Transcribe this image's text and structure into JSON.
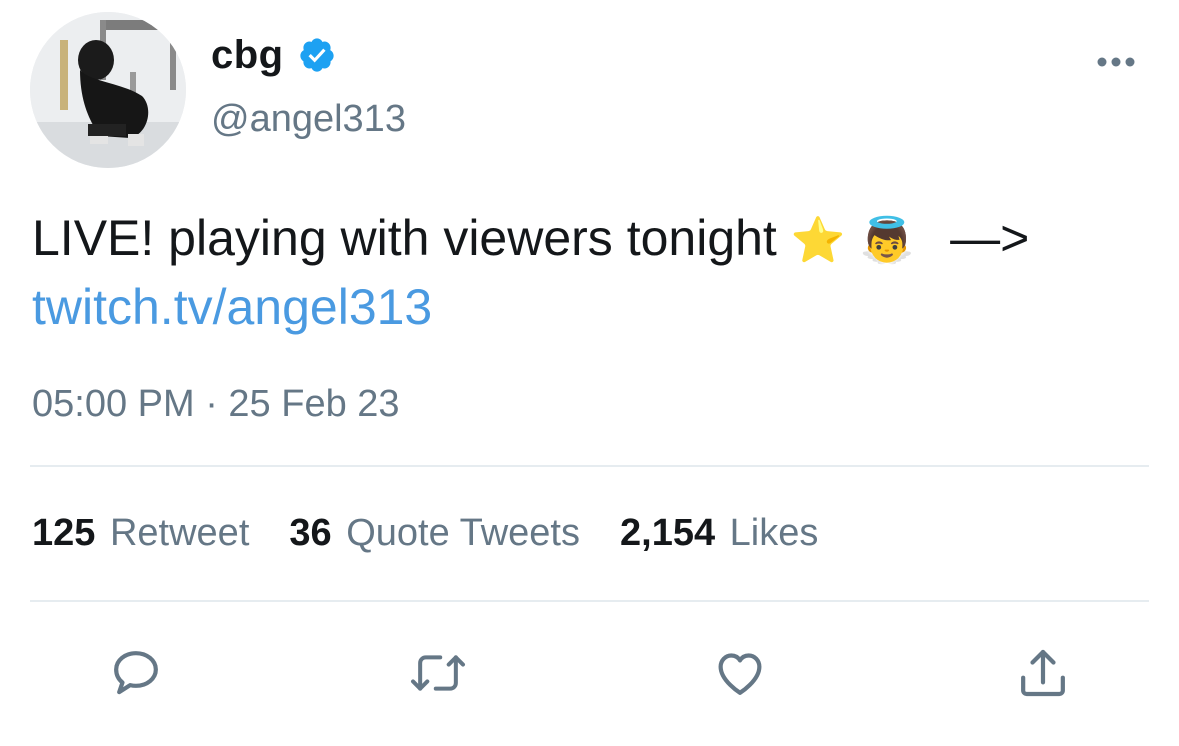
{
  "tweet": {
    "display_name": "cbg",
    "verified": true,
    "handle": "@angel313",
    "text_parts": {
      "main": "LIVE! playing with viewers tonight",
      "emoji_1": "⭐️",
      "emoji_2": "👼",
      "arrow": "—>",
      "link": "twitch.tv/angel313"
    },
    "timestamp": "05:00 PM · 25 Feb 23"
  },
  "stats": {
    "retweets_count": "125",
    "retweets_label": "Retweet",
    "quotes_count": "36",
    "quotes_label": "Quote Tweets",
    "likes_count": "2,154",
    "likes_label": "Likes"
  },
  "icons": {
    "verified": "verified-badge-icon",
    "more": "more-options-icon",
    "reply": "reply-icon",
    "retweet": "retweet-icon",
    "like": "heart-icon",
    "share": "share-icon"
  },
  "colors": {
    "link": "#4a9ae1",
    "verified": "#1da1f2",
    "secondary_text": "#657786",
    "icon": "#657786"
  }
}
